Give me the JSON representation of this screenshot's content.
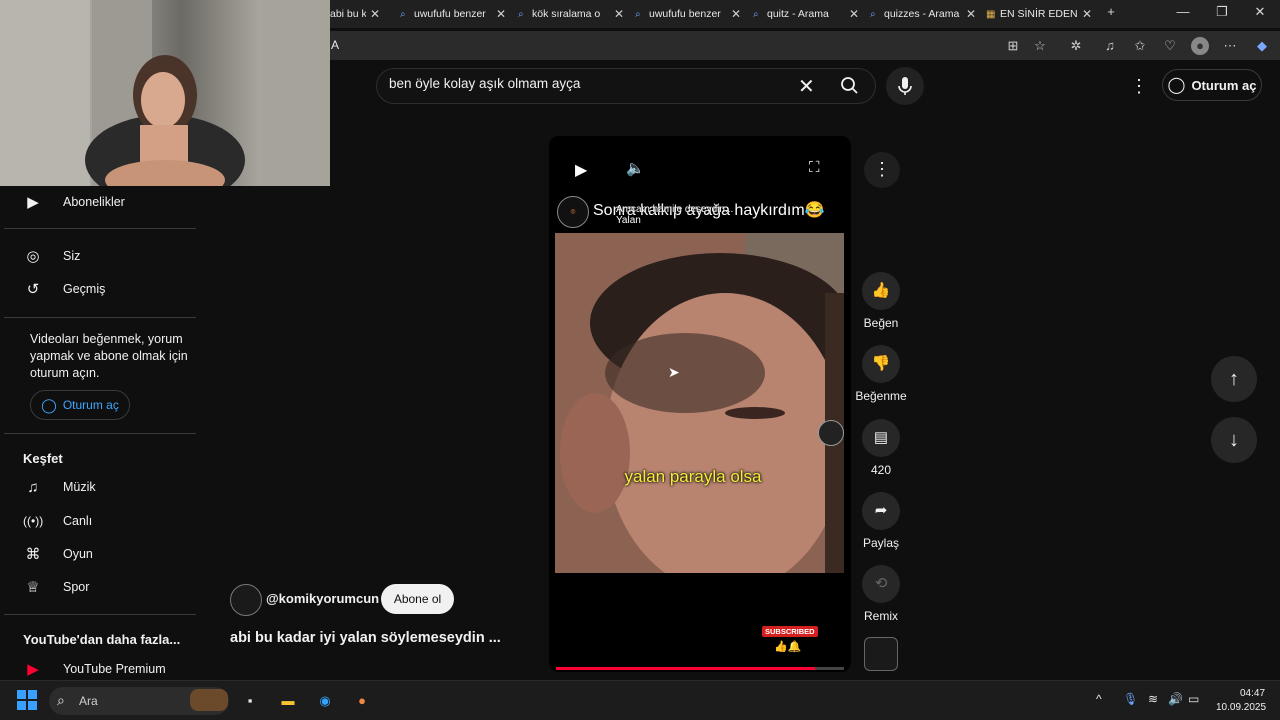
{
  "browser": {
    "tabs": [
      {
        "label": "abi bu kad",
        "icon": "video-favicon"
      },
      {
        "label": "uwufufu benzer",
        "icon": "search-favicon"
      },
      {
        "label": "kök sıralama o",
        "icon": "search-favicon"
      },
      {
        "label": "uwufufu benzer",
        "icon": "search-favicon"
      },
      {
        "label": "quitz - Arama",
        "icon": "search-favicon"
      },
      {
        "label": "quizzes - Arama",
        "icon": "search-favicon"
      },
      {
        "label": "EN SİNİR EDEN",
        "icon": "site-favicon"
      }
    ],
    "new_tab": "+",
    "address_fragment": "A"
  },
  "header": {
    "search_query": "ben öyle kolay aşık olmam ayça",
    "signin_label": "Oturum aç"
  },
  "sidebar": {
    "subscriptions": "Abonelikler",
    "you": "Siz",
    "history": "Geçmiş",
    "signin_message": "Videoları beğenmek, yorum yapmak ve abone olmak için oturum açın.",
    "signin_button": "Oturum aç",
    "explore_heading": "Keşfet",
    "explore": [
      {
        "label": "Müzik",
        "icon": "music-note-icon"
      },
      {
        "label": "Canlı",
        "icon": "live-icon"
      },
      {
        "label": "Oyun",
        "icon": "gaming-icon"
      },
      {
        "label": "Spor",
        "icon": "trophy-icon"
      }
    ],
    "more_heading": "YouTube'dan daha fazla...",
    "premium": "YouTube Premium"
  },
  "player": {
    "overlay_title": "Sonra kalkıp ayağa haykırdım😂",
    "overlay_sub1": "Amcam hamile deseydin...",
    "overlay_sub2": "Yalan",
    "subtitle": "yalan parayla olsa",
    "subscribed_badge": "SUBSCRIBED",
    "progress": 0.9,
    "channel": "@komikyorumcun",
    "subscribe_label": "Abone ol",
    "video_title": "abi bu kadar iyi yalan söylemeseydin ..."
  },
  "actions": {
    "like": "Beğen",
    "dislike": "Beğenme",
    "comments": "420",
    "share": "Paylaş",
    "remix": "Remix"
  },
  "taskbar": {
    "search_placeholder": "Ara",
    "time": "04:47",
    "date": "10.09.2025"
  }
}
